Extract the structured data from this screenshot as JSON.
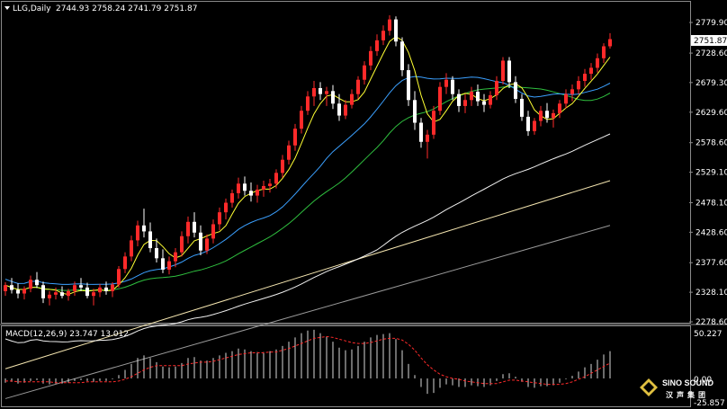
{
  "window": {
    "symbol_label": "LLG,Daily",
    "ohlc": "2744.93 2758.24 2741.79 2751.87"
  },
  "price_axis": {
    "ticks": [
      "2779.90",
      "2728.60",
      "2679.30",
      "2629.60",
      "2578.60",
      "2529.10",
      "2478.10",
      "2428.60",
      "2377.60",
      "2328.10",
      "2278.60"
    ],
    "current_price": "2751.87"
  },
  "macd": {
    "label": "MACD(12,26,9) 23.747 13.012",
    "ticks": [
      "50.227",
      "0.00",
      "-25.857"
    ]
  },
  "watermark": {
    "brand": "SINO SOUND",
    "brand_cn": "汉声集团"
  },
  "colors": {
    "background": "#000000",
    "up_candle": "#ff2a2a",
    "down_candle": "#ffffff",
    "ma_fast": "#ffff33",
    "ma_blue": "#3ba0ff",
    "ma_green": "#2fbf3f",
    "ma_white": "#f0f0f0",
    "ma_cream": "#f5e6b0",
    "ma_grey": "#9a9a9a",
    "macd_signal": "#ff2a2a"
  },
  "chart_data": {
    "type": "candlestick",
    "title": "LLG,Daily",
    "timeframe": "Daily",
    "ylim": [
      2270,
      2800
    ],
    "last_close": 2751.87,
    "candles": [
      [
        2330,
        2345,
        2322,
        2340
      ],
      [
        2340,
        2352,
        2326,
        2332
      ],
      [
        2332,
        2343,
        2318,
        2326
      ],
      [
        2326,
        2338,
        2316,
        2334
      ],
      [
        2334,
        2356,
        2328,
        2349
      ],
      [
        2349,
        2362,
        2335,
        2340
      ],
      [
        2340,
        2346,
        2310,
        2318
      ],
      [
        2318,
        2330,
        2306,
        2324
      ],
      [
        2324,
        2336,
        2316,
        2328
      ],
      [
        2328,
        2338,
        2318,
        2322
      ],
      [
        2322,
        2334,
        2314,
        2330
      ],
      [
        2330,
        2346,
        2322,
        2340
      ],
      [
        2340,
        2352,
        2330,
        2336
      ],
      [
        2336,
        2344,
        2318,
        2322
      ],
      [
        2322,
        2334,
        2306,
        2328
      ],
      [
        2328,
        2342,
        2320,
        2336
      ],
      [
        2336,
        2346,
        2324,
        2330
      ],
      [
        2330,
        2345,
        2320,
        2341
      ],
      [
        2341,
        2372,
        2336,
        2367
      ],
      [
        2367,
        2395,
        2360,
        2388
      ],
      [
        2388,
        2423,
        2380,
        2415
      ],
      [
        2415,
        2448,
        2405,
        2440
      ],
      [
        2440,
        2468,
        2420,
        2430
      ],
      [
        2430,
        2445,
        2395,
        2402
      ],
      [
        2402,
        2418,
        2378,
        2385
      ],
      [
        2385,
        2400,
        2360,
        2366
      ],
      [
        2366,
        2388,
        2358,
        2380
      ],
      [
        2380,
        2402,
        2370,
        2395
      ],
      [
        2395,
        2430,
        2388,
        2422
      ],
      [
        2422,
        2455,
        2410,
        2446
      ],
      [
        2446,
        2462,
        2420,
        2428
      ],
      [
        2428,
        2440,
        2390,
        2398
      ],
      [
        2398,
        2425,
        2392,
        2418
      ],
      [
        2418,
        2450,
        2410,
        2442
      ],
      [
        2442,
        2470,
        2432,
        2462
      ],
      [
        2462,
        2485,
        2450,
        2478
      ],
      [
        2478,
        2500,
        2470,
        2494
      ],
      [
        2494,
        2520,
        2485,
        2510
      ],
      [
        2510,
        2522,
        2490,
        2498
      ],
      [
        2498,
        2512,
        2480,
        2490
      ],
      [
        2490,
        2508,
        2478,
        2500
      ],
      [
        2500,
        2515,
        2488,
        2506
      ],
      [
        2506,
        2518,
        2495,
        2510
      ],
      [
        2510,
        2534,
        2502,
        2528
      ],
      [
        2528,
        2558,
        2520,
        2550
      ],
      [
        2550,
        2582,
        2542,
        2574
      ],
      [
        2574,
        2610,
        2565,
        2602
      ],
      [
        2602,
        2640,
        2594,
        2632
      ],
      [
        2632,
        2665,
        2625,
        2656
      ],
      [
        2656,
        2682,
        2640,
        2670
      ],
      [
        2670,
        2680,
        2650,
        2660
      ],
      [
        2660,
        2672,
        2640,
        2665
      ],
      [
        2665,
        2675,
        2635,
        2644
      ],
      [
        2644,
        2660,
        2615,
        2624
      ],
      [
        2624,
        2650,
        2618,
        2642
      ],
      [
        2642,
        2668,
        2636,
        2660
      ],
      [
        2660,
        2690,
        2652,
        2684
      ],
      [
        2684,
        2715,
        2676,
        2708
      ],
      [
        2708,
        2740,
        2700,
        2732
      ],
      [
        2732,
        2760,
        2724,
        2750
      ],
      [
        2750,
        2775,
        2742,
        2766
      ],
      [
        2766,
        2792,
        2758,
        2785
      ],
      [
        2785,
        2790,
        2740,
        2748
      ],
      [
        2748,
        2755,
        2690,
        2700
      ],
      [
        2700,
        2710,
        2640,
        2650
      ],
      [
        2650,
        2665,
        2600,
        2612
      ],
      [
        2612,
        2620,
        2570,
        2580
      ],
      [
        2580,
        2600,
        2552,
        2592
      ],
      [
        2592,
        2640,
        2585,
        2632
      ],
      [
        2632,
        2680,
        2625,
        2672
      ],
      [
        2672,
        2695,
        2660,
        2684
      ],
      [
        2684,
        2690,
        2650,
        2660
      ],
      [
        2660,
        2668,
        2630,
        2640
      ],
      [
        2640,
        2660,
        2628,
        2650
      ],
      [
        2650,
        2672,
        2640,
        2664
      ],
      [
        2664,
        2676,
        2640,
        2648
      ],
      [
        2648,
        2660,
        2630,
        2642
      ],
      [
        2642,
        2665,
        2636,
        2658
      ],
      [
        2658,
        2690,
        2650,
        2682
      ],
      [
        2682,
        2722,
        2676,
        2716
      ],
      [
        2716,
        2722,
        2670,
        2680
      ],
      [
        2680,
        2690,
        2645,
        2652
      ],
      [
        2652,
        2660,
        2615,
        2622
      ],
      [
        2622,
        2632,
        2590,
        2598
      ],
      [
        2598,
        2620,
        2592,
        2615
      ],
      [
        2615,
        2640,
        2606,
        2632
      ],
      [
        2632,
        2645,
        2612,
        2620
      ],
      [
        2620,
        2634,
        2604,
        2628
      ],
      [
        2628,
        2650,
        2620,
        2644
      ],
      [
        2644,
        2668,
        2636,
        2660
      ],
      [
        2660,
        2676,
        2648,
        2668
      ],
      [
        2668,
        2690,
        2660,
        2682
      ],
      [
        2682,
        2702,
        2672,
        2694
      ],
      [
        2694,
        2712,
        2684,
        2704
      ],
      [
        2704,
        2728,
        2696,
        2720
      ],
      [
        2720,
        2745,
        2712,
        2740
      ],
      [
        2740,
        2762,
        2736,
        2752
      ]
    ],
    "macd_histogram": [
      -5,
      -4,
      -6,
      -5,
      -3,
      -2,
      -6,
      -7,
      -6,
      -6,
      -5,
      -3,
      -2,
      -3,
      -4,
      -3,
      -3,
      -1,
      4,
      10,
      17,
      24,
      27,
      24,
      19,
      14,
      13,
      14,
      18,
      24,
      25,
      21,
      21,
      24,
      27,
      30,
      32,
      35,
      34,
      32,
      31,
      31,
      32,
      34,
      38,
      43,
      48,
      53,
      56,
      57,
      53,
      49,
      43,
      36,
      33,
      34,
      38,
      43,
      48,
      51,
      52,
      53,
      46,
      33,
      17,
      4,
      -10,
      -18,
      -17,
      -11,
      -7,
      -8,
      -10,
      -10,
      -8,
      -9,
      -10,
      -8,
      -3,
      5,
      6,
      2,
      -4,
      -10,
      -11,
      -9,
      -9,
      -8,
      -5,
      -1,
      3,
      8,
      13,
      17,
      22,
      28,
      32
    ],
    "macd_signal": [
      -3,
      -3,
      -4,
      -4,
      -4,
      -4,
      -4,
      -4,
      -5,
      -5,
      -5,
      -5,
      -5,
      -4,
      -4,
      -4,
      -4,
      -4,
      -3,
      -1,
      2,
      6,
      10,
      13,
      15,
      15,
      15,
      15,
      15,
      17,
      18,
      19,
      19,
      20,
      22,
      24,
      26,
      28,
      29,
      30,
      30,
      30,
      31,
      31,
      33,
      35,
      38,
      41,
      44,
      47,
      48,
      49,
      48,
      46,
      44,
      42,
      41,
      41,
      42,
      44,
      46,
      47,
      47,
      45,
      40,
      33,
      24,
      16,
      10,
      5,
      2,
      0,
      -1,
      -3,
      -4,
      -5,
      -6,
      -6,
      -6,
      -4,
      -2,
      -2,
      -3,
      -4,
      -5,
      -6,
      -7,
      -7,
      -7,
      -6,
      -4,
      -1,
      2,
      6,
      10,
      14,
      18
    ]
  }
}
